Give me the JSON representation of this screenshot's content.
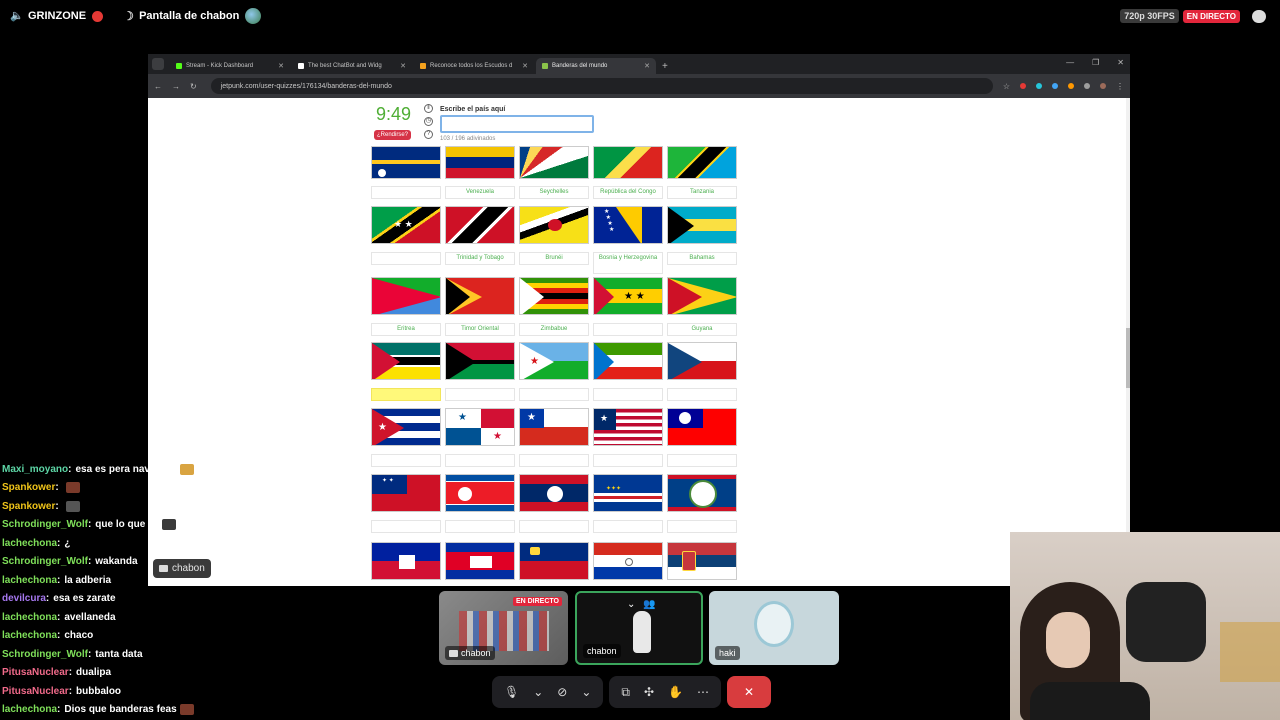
{
  "topbar": {
    "server": "GRINZONE",
    "channel": "Pantalla de chabon",
    "quality": "720p 30FPS",
    "live": "EN DIRECTO"
  },
  "browser": {
    "tabs": [
      {
        "title": "Stream - Kick Dashboard",
        "color": "#53fc18"
      },
      {
        "title": "The best ChatBot and Widg",
        "color": "#ffffff"
      },
      {
        "title": "Reconoce todos los Escudos d",
        "color": "#f4a21e"
      },
      {
        "title": "Banderas del mundo",
        "color": "#8bc34a"
      }
    ],
    "url": "jetpunk.com/user-quizzes/176134/banderas-del-mundo"
  },
  "quiz": {
    "timer": "9:49",
    "give_up": "¿Rendirse?",
    "prompt": "Escribe el país aquí",
    "progress": "103 / 196 adivinados"
  },
  "flags": [
    {
      "name": "nauru",
      "label": ""
    },
    {
      "name": "venezuela",
      "label": "Venezuela"
    },
    {
      "name": "seychelles",
      "label": "Seychelles"
    },
    {
      "name": "congo",
      "label": "República del Congo"
    },
    {
      "name": "tanzania",
      "label": "Tanzania"
    },
    {
      "name": "saint-kitts",
      "label": ""
    },
    {
      "name": "trinidad",
      "label": "Trinidad y Tobago"
    },
    {
      "name": "brunei",
      "label": "Brunéi"
    },
    {
      "name": "bosnia",
      "label": "Bosnia y Herzegovina"
    },
    {
      "name": "bahamas",
      "label": "Bahamas"
    },
    {
      "name": "eritrea",
      "label": "Eritrea"
    },
    {
      "name": "east-timor",
      "label": "Timor Oriental"
    },
    {
      "name": "zimbabwe",
      "label": "Zimbabue"
    },
    {
      "name": "sao-tome",
      "label": ""
    },
    {
      "name": "guyana",
      "label": "Guyana"
    },
    {
      "name": "mozambique",
      "label": ""
    },
    {
      "name": "vanuatu",
      "label": ""
    },
    {
      "name": "djibouti",
      "label": ""
    },
    {
      "name": "equatorial-guinea",
      "label": ""
    },
    {
      "name": "czechia",
      "label": ""
    },
    {
      "name": "cuba",
      "label": ""
    },
    {
      "name": "panama",
      "label": ""
    },
    {
      "name": "chile",
      "label": ""
    },
    {
      "name": "liberia",
      "label": ""
    },
    {
      "name": "taiwan",
      "label": ""
    },
    {
      "name": "samoa",
      "label": ""
    },
    {
      "name": "north-korea",
      "label": ""
    },
    {
      "name": "laos",
      "label": ""
    },
    {
      "name": "cape-verde",
      "label": ""
    },
    {
      "name": "belize",
      "label": ""
    },
    {
      "name": "haiti",
      "label": ""
    },
    {
      "name": "cambodia",
      "label": ""
    },
    {
      "name": "liechtenstein",
      "label": ""
    },
    {
      "name": "paraguay",
      "label": ""
    },
    {
      "name": "serbia",
      "label": ""
    }
  ],
  "chat": [
    {
      "user": "Maxi_moyano",
      "text": "esa es pera navideño",
      "color": "#5dd6a6"
    },
    {
      "user": "Spankower",
      "text": "",
      "color": "#f0c419"
    },
    {
      "user": "Spankower",
      "text": "",
      "color": "#f0c419"
    },
    {
      "user": "Schrodinger_Wolf",
      "text": "que lo que es",
      "color": "#7fe05a"
    },
    {
      "user": "lachechona",
      "text": "¿",
      "color": "#7fe05a"
    },
    {
      "user": "Schrodinger_Wolf",
      "text": "wakanda",
      "color": "#7fe05a"
    },
    {
      "user": "lachechona",
      "text": "la adberia",
      "color": "#7fe05a"
    },
    {
      "user": "devilcura",
      "text": "esa es zarate",
      "color": "#a678f0"
    },
    {
      "user": "lachechona",
      "text": "avellaneda",
      "color": "#7fe05a"
    },
    {
      "user": "lachechona",
      "text": "chaco",
      "color": "#7fe05a"
    },
    {
      "user": "Schrodinger_Wolf",
      "text": "tanta data",
      "color": "#7fe05a"
    },
    {
      "user": "PitusaNuclear",
      "text": "dualipa",
      "color": "#f06a8a"
    },
    {
      "user": "PitusaNuclear",
      "text": "bubbaloo",
      "color": "#f06a8a"
    },
    {
      "user": "lachechona",
      "text": "Dios que banderas feas",
      "color": "#7fe05a"
    }
  ],
  "screen_chip": "chabon",
  "tiles": [
    {
      "name": "chabon",
      "live": "EN DIRECTO"
    },
    {
      "name": "chabon"
    },
    {
      "name": "haki"
    }
  ]
}
